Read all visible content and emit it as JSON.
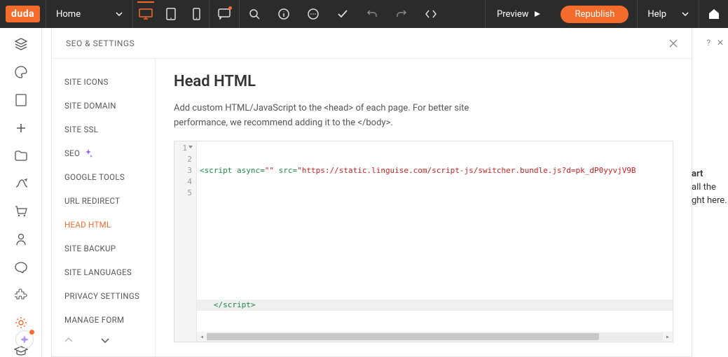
{
  "topbar": {
    "logo": "duda",
    "page_selector": "Home",
    "preview": "Preview",
    "republish": "Republish",
    "help": "Help"
  },
  "panel": {
    "title": "SEO & SETTINGS",
    "side_items": [
      "SITE ICONS",
      "SITE DOMAIN",
      "SITE SSL",
      "SEO",
      "GOOGLE TOOLS",
      "URL REDIRECT",
      "HEAD HTML",
      "SITE BACKUP",
      "SITE LANGUAGES",
      "PRIVACY SETTINGS",
      "MANAGE FORM"
    ],
    "active_index": 6
  },
  "content": {
    "heading": "Head HTML",
    "description": "Add custom HTML/JavaScript to the <head> of each page. For better site performance, we recommend adding it to the </body>."
  },
  "code": {
    "line1_prefix": "<script",
    "line1_attr1": " async",
    "line1_eq": "=",
    "line1_val1": "\"\"",
    "line1_attr2": " src",
    "line1_val2": "\"https://static.linguise.com/script-js/switcher.bundle.js?d=pk_dP0yyvjV9B",
    "line5": "</script>",
    "line_numbers": [
      "1",
      "2",
      "3",
      "4",
      "5"
    ]
  },
  "right_fragments": {
    "help_q": "?",
    "close_x": "✕",
    "f1": "art",
    "f2": "all the",
    "f3": "ght here."
  },
  "colors": {
    "accent": "#f46c2c"
  }
}
